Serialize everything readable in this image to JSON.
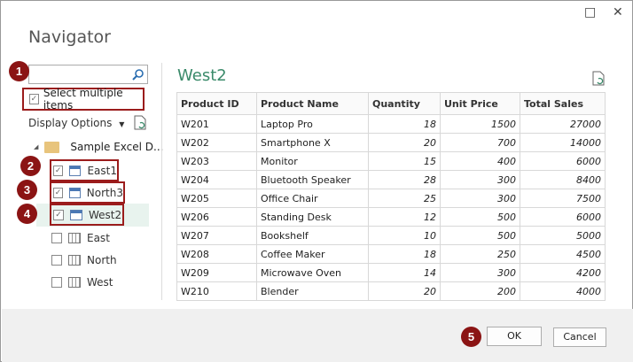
{
  "dialog": {
    "title": "Navigator",
    "maximize_icon": "□",
    "close_icon": "✕"
  },
  "left": {
    "search_placeholder": "",
    "select_multiple": "Select multiple items",
    "display_options": "Display Options",
    "folder": "Sample Excel D...",
    "items": [
      {
        "label": "East1",
        "checked": true,
        "type": "table"
      },
      {
        "label": "North3",
        "checked": true,
        "type": "table"
      },
      {
        "label": "West2",
        "checked": true,
        "type": "table",
        "selected": true
      },
      {
        "label": "East",
        "checked": false,
        "type": "sheet"
      },
      {
        "label": "North",
        "checked": false,
        "type": "sheet"
      },
      {
        "label": "West",
        "checked": false,
        "type": "sheet"
      }
    ]
  },
  "badges": [
    "1",
    "2",
    "3",
    "4",
    "5"
  ],
  "preview": {
    "title": "West2",
    "columns": [
      "Product ID",
      "Product Name",
      "Quantity",
      "Unit Price",
      "Total Sales"
    ],
    "rows": [
      [
        "W201",
        "Laptop Pro",
        "18",
        "1500",
        "27000"
      ],
      [
        "W202",
        "Smartphone X",
        "20",
        "700",
        "14000"
      ],
      [
        "W203",
        "Monitor",
        "15",
        "400",
        "6000"
      ],
      [
        "W204",
        "Bluetooth Speaker",
        "28",
        "300",
        "8400"
      ],
      [
        "W205",
        "Office Chair",
        "25",
        "300",
        "7500"
      ],
      [
        "W206",
        "Standing Desk",
        "12",
        "500",
        "6000"
      ],
      [
        "W207",
        "Bookshelf",
        "10",
        "500",
        "5000"
      ],
      [
        "W208",
        "Coffee Maker",
        "18",
        "250",
        "4500"
      ],
      [
        "W209",
        "Microwave Oven",
        "14",
        "300",
        "4200"
      ],
      [
        "W210",
        "Blender",
        "20",
        "200",
        "4000"
      ]
    ]
  },
  "footer": {
    "ok": "OK",
    "cancel": "Cancel"
  },
  "colors": {
    "accent": "#3a8a6a",
    "badge": "#8b1414"
  }
}
